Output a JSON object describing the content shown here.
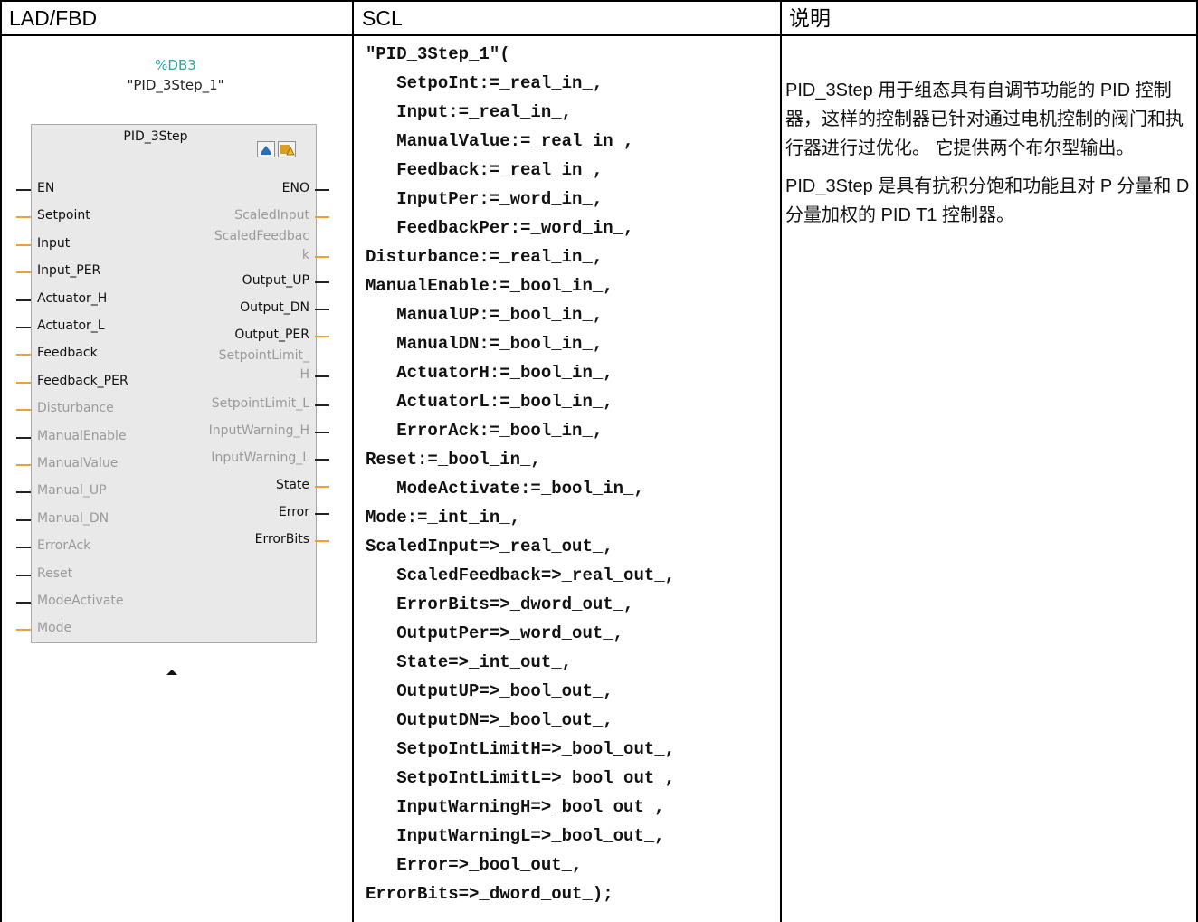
{
  "headers": {
    "lad_fbd": "LAD/FBD",
    "scl": "SCL",
    "description": "说明"
  },
  "fbd": {
    "db_address": "%DB3",
    "instance_name": "\"PID_3Step_1\"",
    "block_type": "PID_3Step",
    "inputs": [
      {
        "label": "EN",
        "active": true,
        "wire": "bool"
      },
      {
        "label": "Setpoint",
        "active": true,
        "wire": "data"
      },
      {
        "label": "Input",
        "active": true,
        "wire": "data"
      },
      {
        "label": "Input_PER",
        "active": true,
        "wire": "data"
      },
      {
        "label": "Actuator_H",
        "active": true,
        "wire": "bool"
      },
      {
        "label": "Actuator_L",
        "active": true,
        "wire": "bool"
      },
      {
        "label": "Feedback",
        "active": true,
        "wire": "data"
      },
      {
        "label": "Feedback_PER",
        "active": true,
        "wire": "data"
      },
      {
        "label": "Disturbance",
        "active": false,
        "wire": "data"
      },
      {
        "label": "ManualEnable",
        "active": false,
        "wire": "bool"
      },
      {
        "label": "ManualValue",
        "active": false,
        "wire": "data"
      },
      {
        "label": "Manual_UP",
        "active": false,
        "wire": "bool"
      },
      {
        "label": "Manual_DN",
        "active": false,
        "wire": "bool"
      },
      {
        "label": "ErrorAck",
        "active": false,
        "wire": "bool"
      },
      {
        "label": "Reset",
        "active": false,
        "wire": "bool"
      },
      {
        "label": "ModeActivate",
        "active": false,
        "wire": "bool"
      },
      {
        "label": "Mode",
        "active": false,
        "wire": "data"
      }
    ],
    "outputs": [
      {
        "label": "ENO",
        "active": true,
        "wire": "bool"
      },
      {
        "label": "ScaledInput",
        "active": false,
        "wire": "data"
      },
      {
        "label": "ScaledFeedbac",
        "active": false,
        "wire": "none"
      },
      {
        "label": "k",
        "active": false,
        "wire": "data"
      },
      {
        "label": "Output_UP",
        "active": true,
        "wire": "bool"
      },
      {
        "label": "Output_DN",
        "active": true,
        "wire": "bool"
      },
      {
        "label": "Output_PER",
        "active": true,
        "wire": "data"
      },
      {
        "label": "SetpointLimit_",
        "active": false,
        "wire": "none"
      },
      {
        "label": "H",
        "active": false,
        "wire": "bool"
      },
      {
        "label": "SetpointLimit_L",
        "active": false,
        "wire": "bool"
      },
      {
        "label": "InputWarning_H",
        "active": false,
        "wire": "bool"
      },
      {
        "label": "InputWarning_L",
        "active": false,
        "wire": "bool"
      },
      {
        "label": "State",
        "active": true,
        "wire": "data"
      },
      {
        "label": "Error",
        "active": true,
        "wire": "bool"
      },
      {
        "label": "ErrorBits",
        "active": true,
        "wire": "data"
      }
    ]
  },
  "scl": {
    "lines": [
      "\"PID_3Step_1\"(",
      "   SetpoInt:=_real_in_,",
      "   Input:=_real_in_,",
      "   ManualValue:=_real_in_,",
      "   Feedback:=_real_in_,",
      "   InputPer:=_word_in_,",
      "   FeedbackPer:=_word_in_,",
      "Disturbance:=_real_in_,",
      "ManualEnable:=_bool_in_,",
      "   ManualUP:=_bool_in_,",
      "   ManualDN:=_bool_in_,",
      "   ActuatorH:=_bool_in_,",
      "   ActuatorL:=_bool_in_,",
      "   ErrorAck:=_bool_in_,",
      "Reset:=_bool_in_,",
      "   ModeActivate:=_bool_in_,",
      "Mode:=_int_in_,",
      "ScaledInput=>_real_out_,",
      "   ScaledFeedback=>_real_out_,",
      "   ErrorBits=>_dword_out_,",
      "   OutputPer=>_word_out_,",
      "   State=>_int_out_,",
      "   OutputUP=>_bool_out_,",
      "   OutputDN=>_bool_out_,",
      "   SetpoIntLimitH=>_bool_out_,",
      "   SetpoIntLimitL=>_bool_out_,",
      "   InputWarningH=>_bool_out_,",
      "   InputWarningL=>_bool_out_,",
      "   Error=>_bool_out_,",
      "ErrorBits=>_dword_out_);"
    ]
  },
  "description": {
    "paragraphs": [
      "PID_3Step 用于组态具有自调节功能的 PID 控制器，这样的控制器已针对通过电机控制的阀门和执行器进行过优化。 它提供两个布尔型输出。",
      "PID_3Step 是具有抗积分饱和功能且对 P 分量和 D 分量加权的 PID T1 控制器。"
    ]
  }
}
